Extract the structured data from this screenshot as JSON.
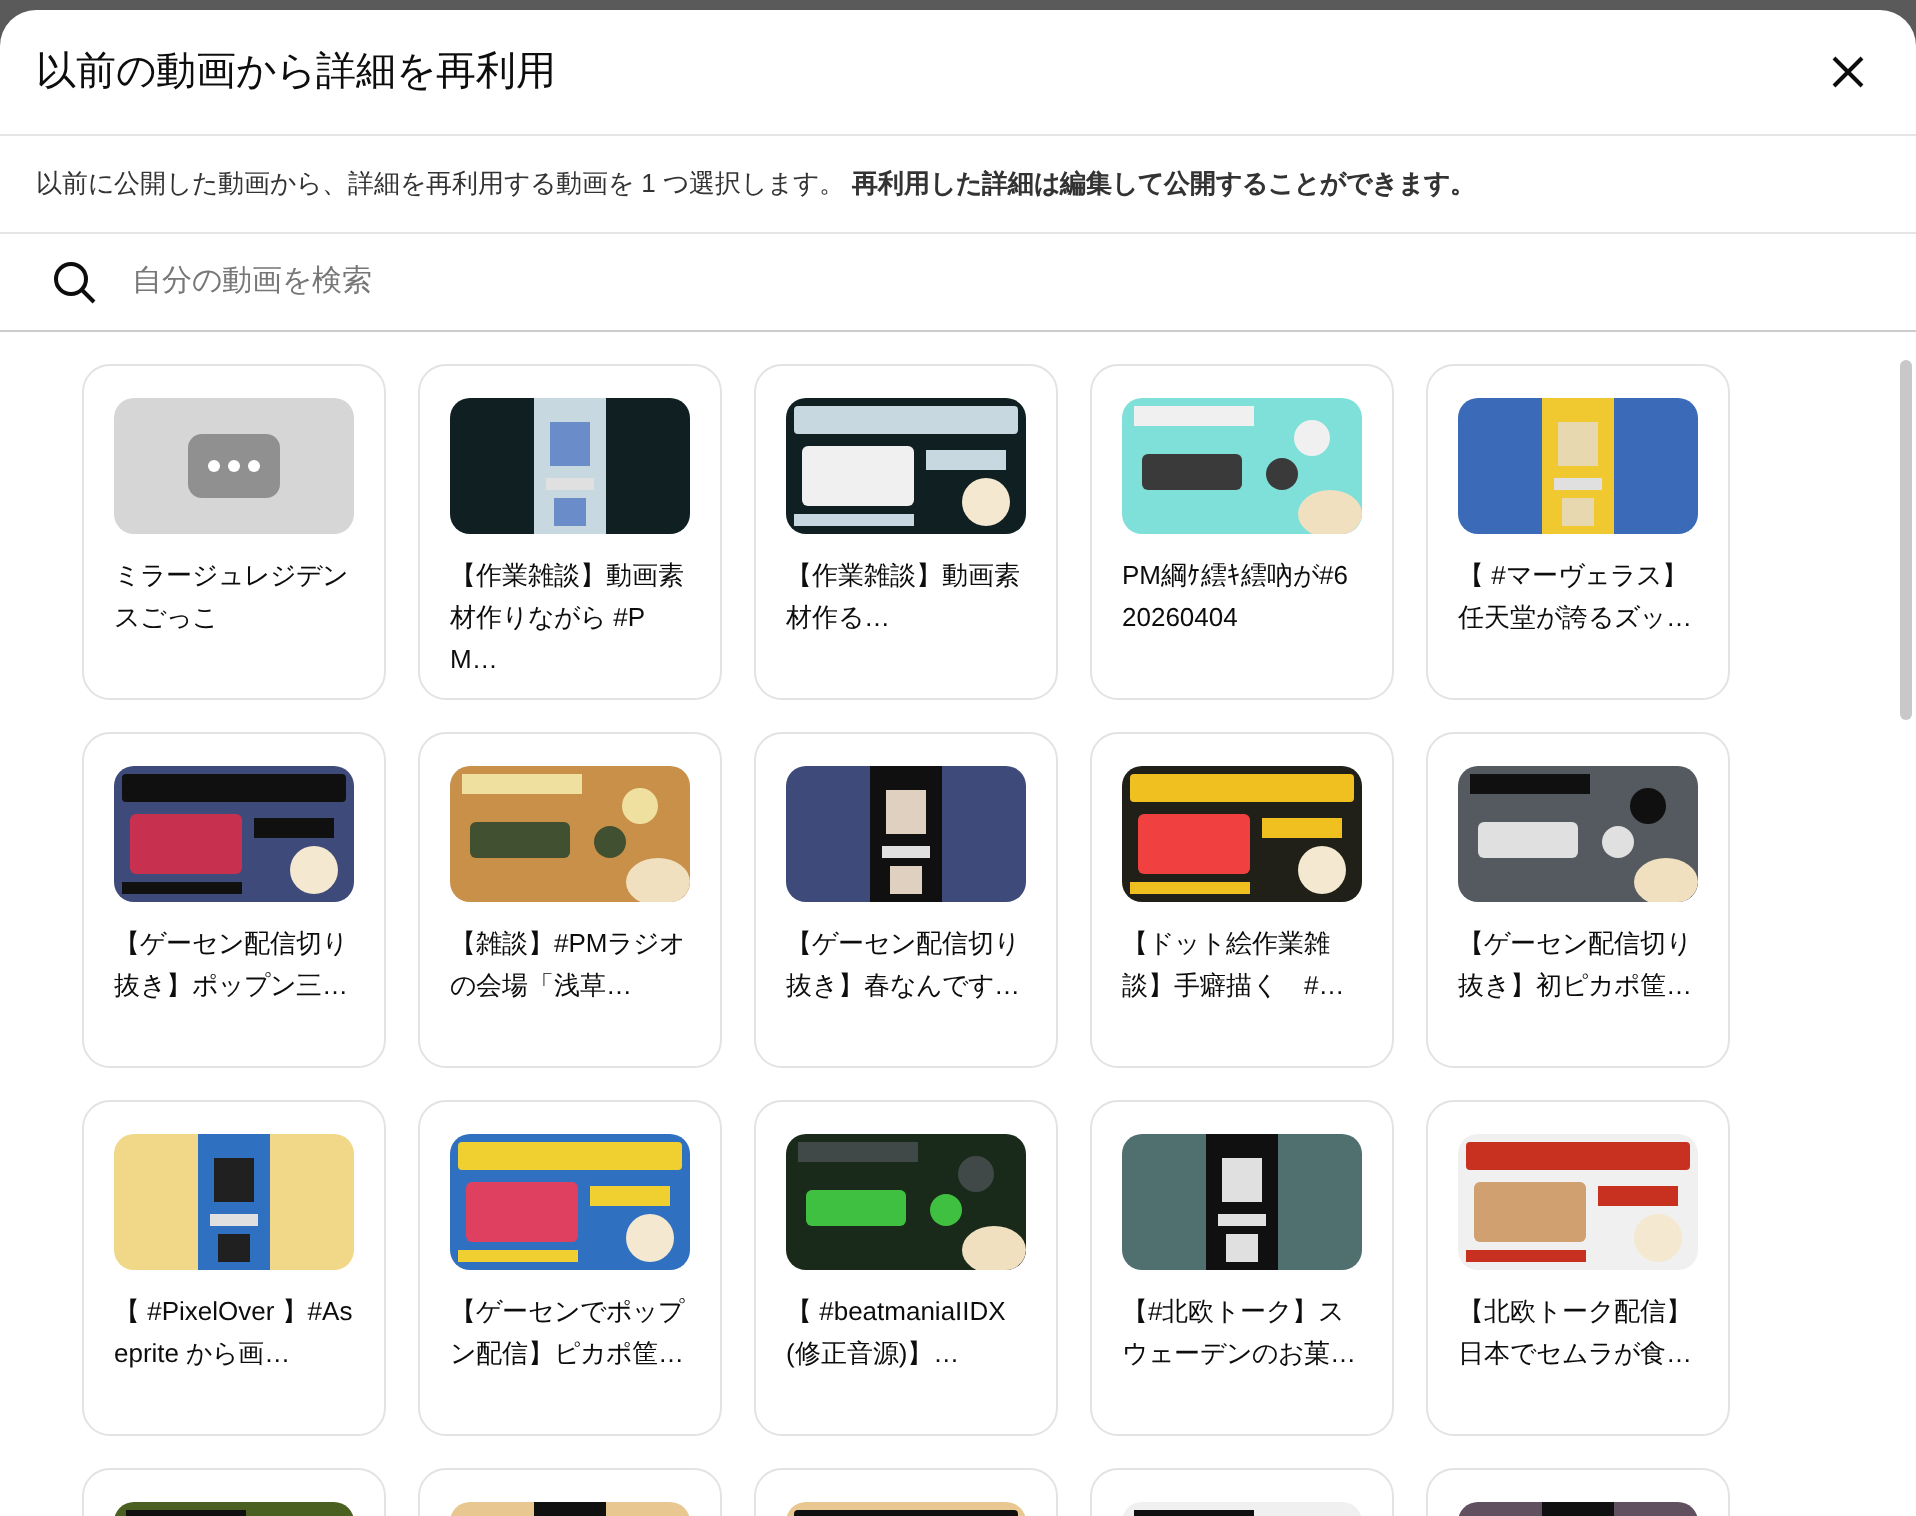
{
  "dialog": {
    "title": "以前の動画から詳細を再利用",
    "description": "以前に公開した動画から、詳細を再利用する動画を 1 つ選択します。 **再利用した詳細は編集して公開することができます。**",
    "search": {
      "placeholder": "自分の動画を検索"
    },
    "videos": [
      {
        "kind": "placeholder",
        "title": "ミラージュレジデンスごっこ"
      },
      {
        "kind": "picture",
        "title": "【作業雑談】動画素材作りながら #PM…"
      },
      {
        "kind": "picture",
        "title": "【作業雑談】動画素材作る…"
      },
      {
        "kind": "picture",
        "title": "PM綱ｹ繧ｷ繧吶が#620260404"
      },
      {
        "kind": "picture",
        "title": "【 #マーヴェラス】任天堂が誇るズッ…"
      },
      {
        "kind": "picture",
        "title": "【ゲーセン配信切り抜き】ポップン三…"
      },
      {
        "kind": "picture",
        "title": "【雑談】#PMラジオの会場「浅草…"
      },
      {
        "kind": "picture",
        "title": "【ゲーセン配信切り抜き】春なんです…"
      },
      {
        "kind": "picture",
        "title": "【ドット絵作業雑談】手癖描く　#…"
      },
      {
        "kind": "picture",
        "title": "【ゲーセン配信切り抜き】初ピカポ筐…"
      },
      {
        "kind": "picture",
        "title": "【 #PixelOver 】#Aseprite から画…"
      },
      {
        "kind": "picture",
        "title": "【ゲーセンでポップン配信】ピカポ筐…"
      },
      {
        "kind": "picture",
        "title": "【 #beatmaniaIIDX (修正音源)】…"
      },
      {
        "kind": "picture",
        "title": "【#北欧トーク】スウェーデンのお菓…"
      },
      {
        "kind": "picture",
        "title": "【北欧トーク配信】日本でセムラが食…"
      },
      {
        "kind": "picture"
      },
      {
        "kind": "picture"
      },
      {
        "kind": "picture"
      },
      {
        "kind": "picture"
      },
      {
        "kind": "picture"
      }
    ]
  }
}
